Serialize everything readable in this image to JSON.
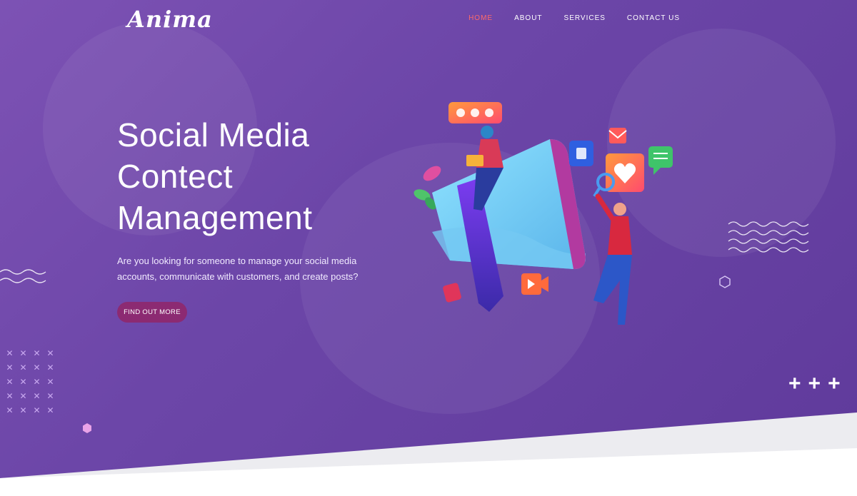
{
  "brand": {
    "logo_text": "Anima"
  },
  "nav": {
    "items": [
      {
        "label": "HOME",
        "active": true
      },
      {
        "label": "ABOUT",
        "active": false
      },
      {
        "label": "SERVICES",
        "active": false
      },
      {
        "label": "CONTACT US",
        "active": false
      }
    ],
    "active_color": "#ff6a6a"
  },
  "hero": {
    "title_lines": [
      "Social Media",
      "Contect",
      "Management"
    ],
    "description": "Are you looking for someone to manage your social media accounts, communicate with customers, and create posts?",
    "cta_label": "FIND OUT MORE",
    "cta_color": "#8c2a72",
    "background_color": "#6c46a8"
  },
  "illustration": {
    "description_icons": [
      "megaphone-icon",
      "heart-icon",
      "chat-icon",
      "mail-icon",
      "video-icon",
      "search-icon"
    ]
  }
}
